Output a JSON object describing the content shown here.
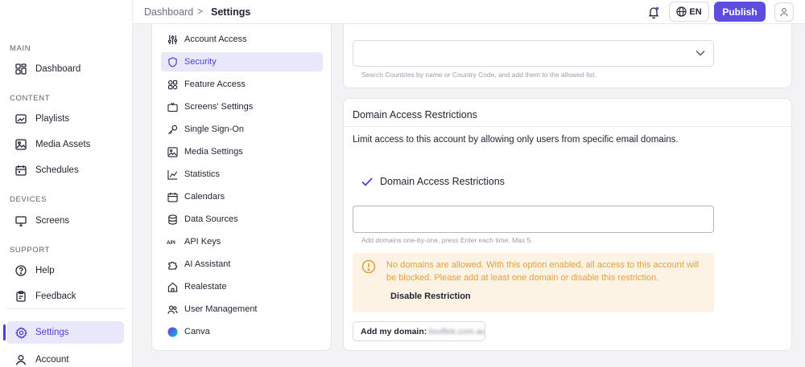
{
  "sidebar": {
    "sections": [
      {
        "label": "MAIN",
        "items": [
          {
            "label": "Dashboard",
            "icon": "dashboard-icon"
          }
        ]
      },
      {
        "label": "CONTENT",
        "items": [
          {
            "label": "Playlists",
            "icon": "playlist-icon"
          },
          {
            "label": "Media Assets",
            "icon": "image-icon"
          },
          {
            "label": "Schedules",
            "icon": "calendar-icon"
          }
        ]
      },
      {
        "label": "DEVICES",
        "items": [
          {
            "label": "Screens",
            "icon": "monitor-icon"
          }
        ]
      },
      {
        "label": "SUPPORT",
        "items": [
          {
            "label": "Help",
            "icon": "help-circle-icon"
          },
          {
            "label": "Feedback",
            "icon": "clipboard-icon"
          }
        ]
      }
    ],
    "bottom": [
      {
        "label": "Settings",
        "icon": "gear-icon",
        "active": true
      },
      {
        "label": "Account",
        "icon": "user-icon"
      }
    ]
  },
  "topbar": {
    "breadcrumb": [
      "Dashboard",
      "Settings"
    ],
    "breadcrumb_separator": ">",
    "language": "EN",
    "publish_label": "Publish"
  },
  "settings_menu": [
    {
      "label": "Account Access",
      "icon": "sliders-icon"
    },
    {
      "label": "Security",
      "icon": "shield-icon",
      "active": true
    },
    {
      "label": "Feature Access",
      "icon": "grid-icon"
    },
    {
      "label": "Screens' Settings",
      "icon": "tv-icon"
    },
    {
      "label": "Single Sign-On",
      "icon": "key-icon"
    },
    {
      "label": "Media Settings",
      "icon": "media-icon"
    },
    {
      "label": "Statistics",
      "icon": "chart-icon"
    },
    {
      "label": "Calendars",
      "icon": "calendar-icon"
    },
    {
      "label": "Data Sources",
      "icon": "database-icon"
    },
    {
      "label": "API Keys",
      "icon": "api-icon"
    },
    {
      "label": "AI Assistant",
      "icon": "puzzle-icon"
    },
    {
      "label": "Realestate",
      "icon": "home-icon"
    },
    {
      "label": "User Management",
      "icon": "users-icon"
    },
    {
      "label": "Canva",
      "icon": "canva-icon"
    }
  ],
  "country_card": {
    "help_text": "Search Countries by name or Country Code, and add them to the allowed list."
  },
  "domain_card": {
    "title": "Domain Access Restrictions",
    "description": "Limit access to this account by allowing only users from specific email domains.",
    "checkbox_label": "Domain Access Restrictions",
    "input_value": "",
    "input_help": "Add domains one-by-one, press Enter each time. Max 5.",
    "warning_text": "No domains are allowed. With this option enabled, all access to this account will be blocked. Please add at least one domain or disable this restriction.",
    "warning_action": "Disable Restriction",
    "add_my_domain_label": "Add my domain:",
    "my_domain_value": "bsoftek.com.au"
  },
  "colors": {
    "accent": "#5b4ee0",
    "active_bg": "#e9e8fb",
    "warning_text": "#e3a03c",
    "warning_bg": "#fdf3e4"
  }
}
